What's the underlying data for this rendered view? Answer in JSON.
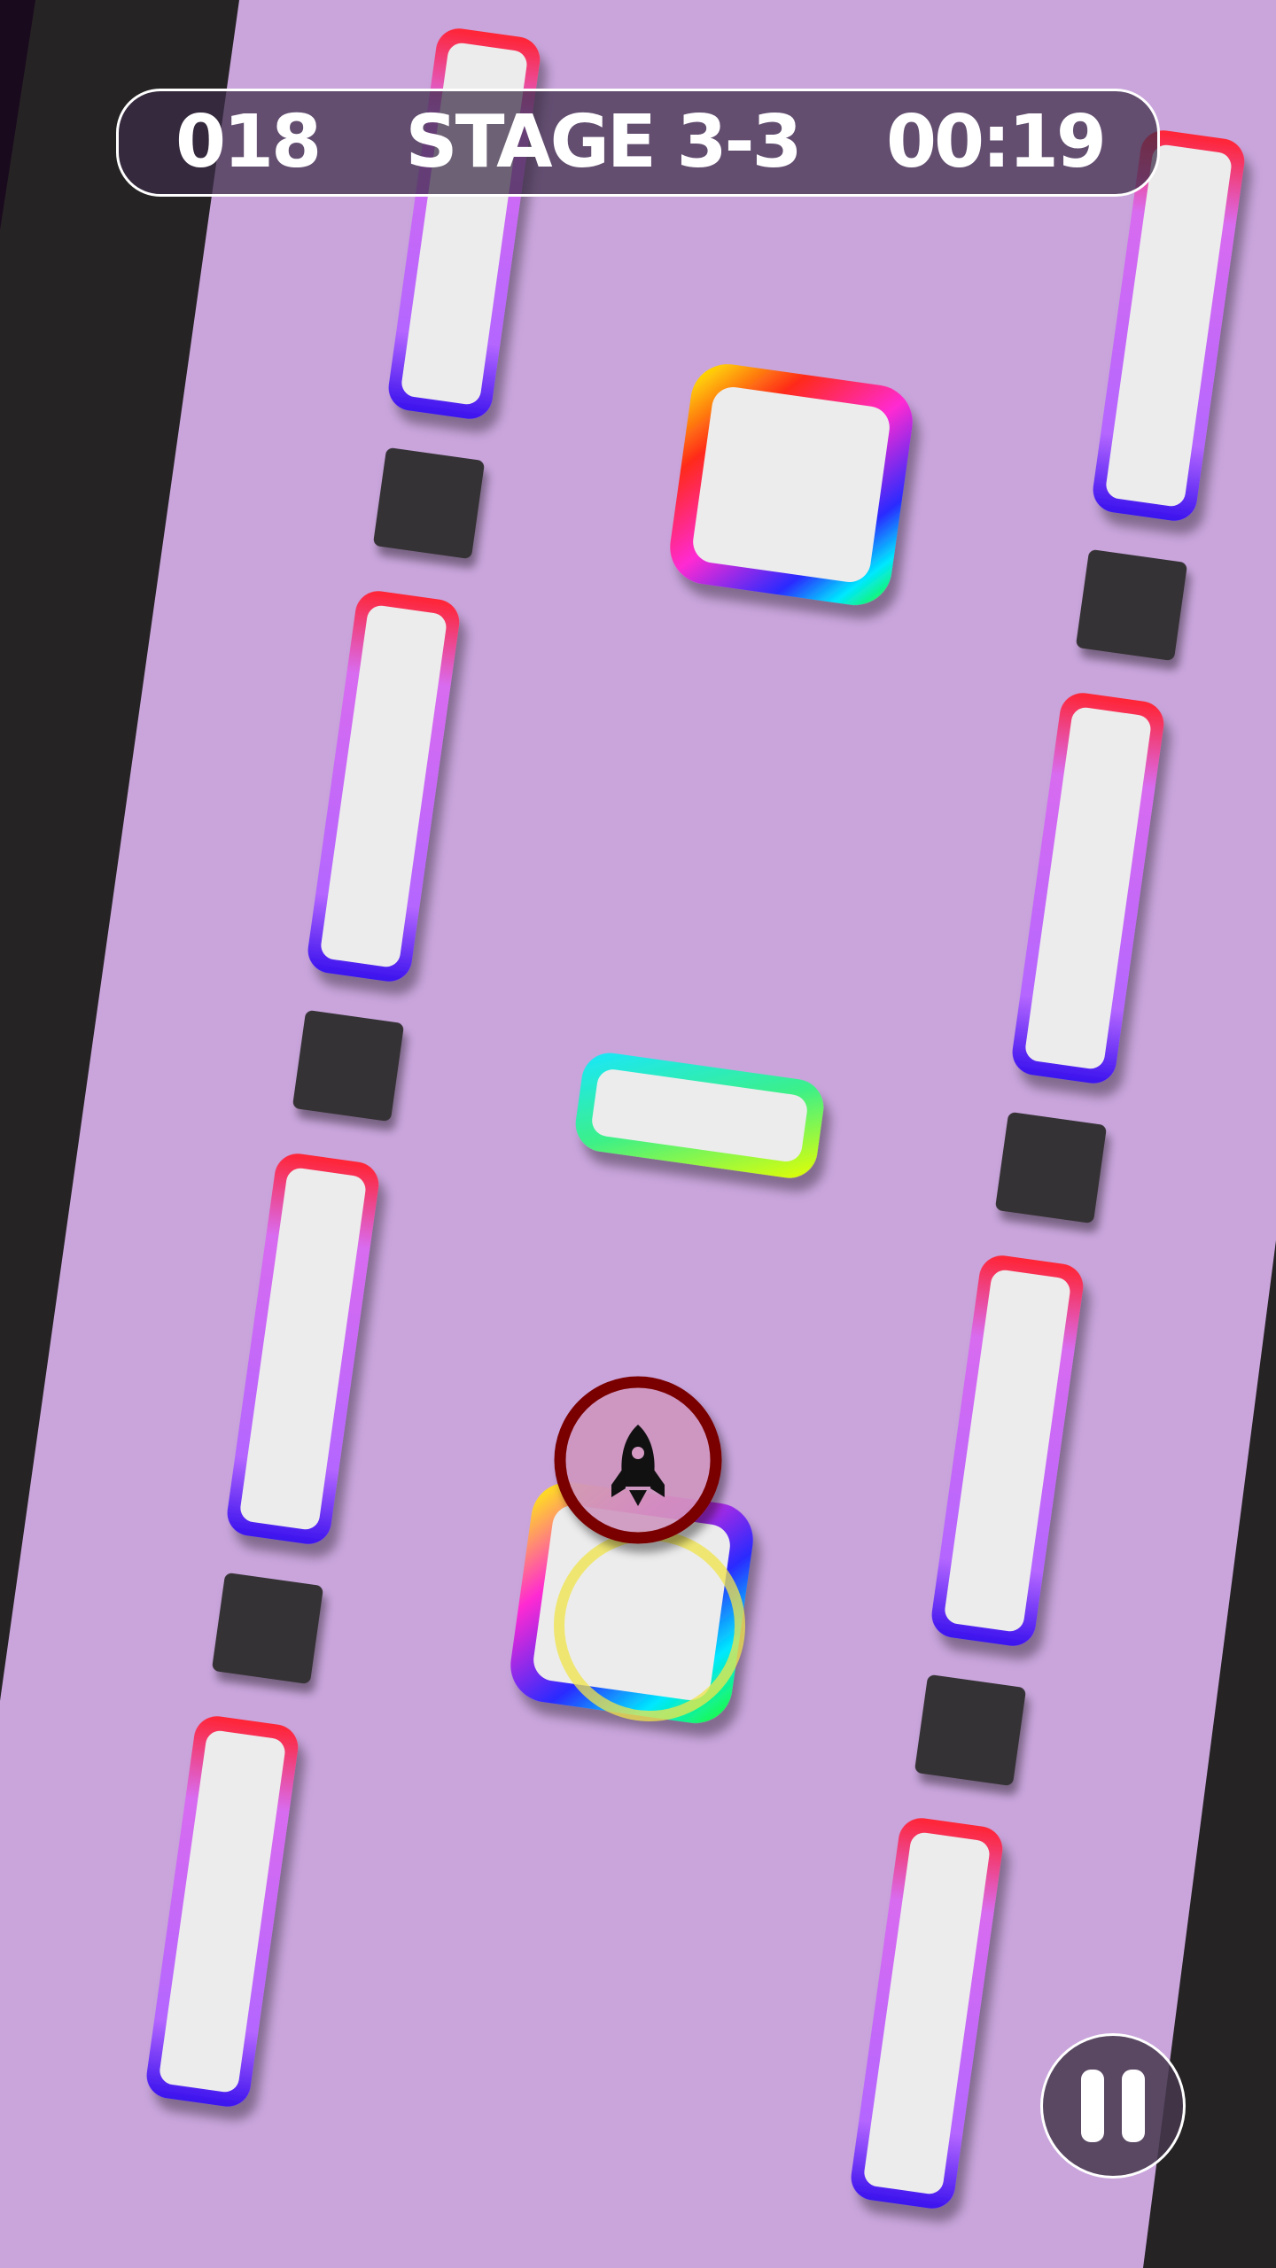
{
  "hud": {
    "score": "018",
    "stage": "STAGE 3-3",
    "timer": "00:19"
  },
  "icons": {
    "pause": "pause-icon",
    "rocket": "rocket-icon"
  },
  "colors": {
    "background": "#c9a5dc",
    "wall": "#2a2728",
    "panel_fill": "#ececec",
    "red_edge": "#ff2a3a",
    "blue_edge": "#4a18f0",
    "power_up_ring": "#7a0000",
    "target_ring": "#f0e44a"
  }
}
